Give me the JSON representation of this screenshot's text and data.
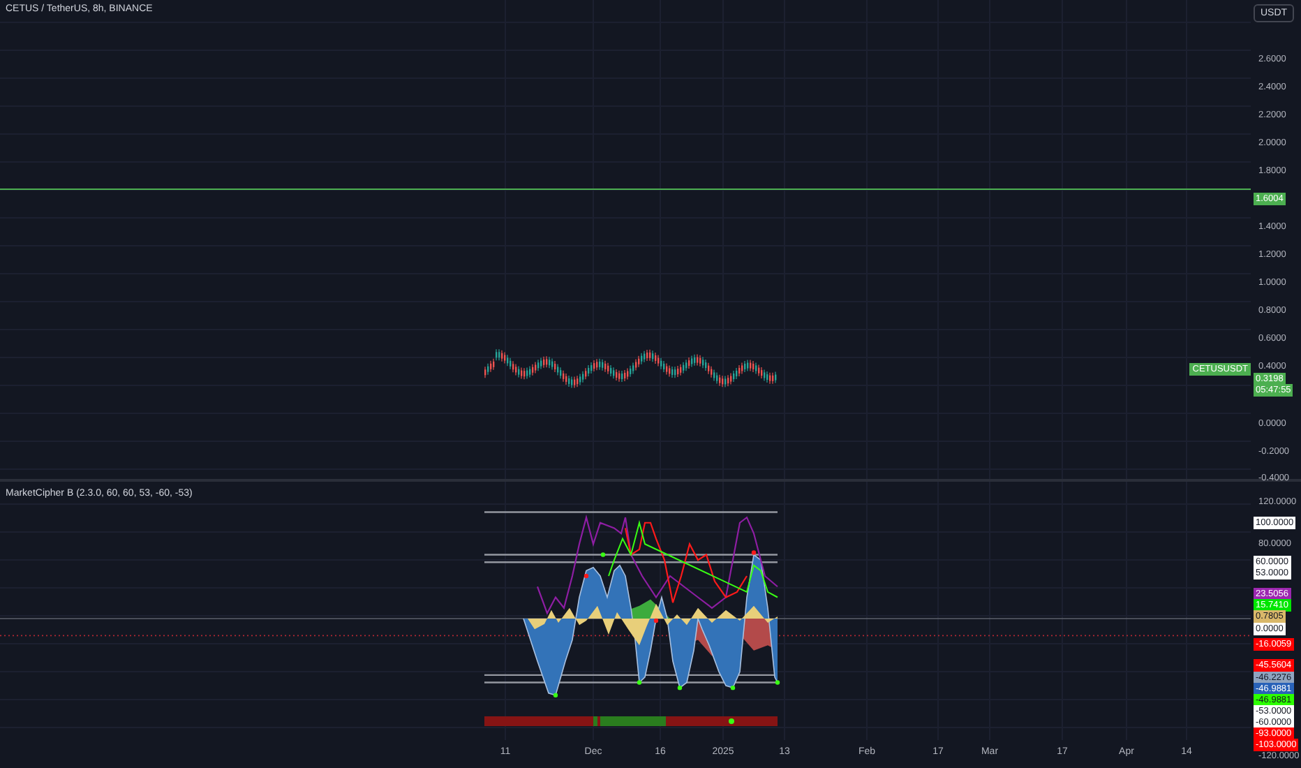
{
  "chart_title": "CETUS / TetherUS, 8h, BINANCE",
  "currency_button": "USDT",
  "price_axis": [
    {
      "kind": "tick",
      "text": "2.6000"
    },
    {
      "kind": "tick",
      "text": "2.4000"
    },
    {
      "kind": "tick",
      "text": "2.2000"
    },
    {
      "kind": "tick",
      "text": "2.0000"
    },
    {
      "kind": "tick",
      "text": "1.8000"
    },
    {
      "kind": "badge",
      "text": "1.6004",
      "color": "#4caf50"
    },
    {
      "kind": "tick",
      "text": "1.4000"
    },
    {
      "kind": "tick",
      "text": "1.2000"
    },
    {
      "kind": "tick",
      "text": "1.0000"
    },
    {
      "kind": "tick",
      "text": "0.8000"
    },
    {
      "kind": "tick",
      "text": "0.6000"
    },
    {
      "kind": "tick",
      "text": "0.4000"
    },
    {
      "kind": "badge",
      "text": "0.3198",
      "color": "#4caf50"
    },
    {
      "kind": "badge",
      "text": "05:47:55",
      "color": "#4caf50"
    },
    {
      "kind": "tick",
      "text": "0.0000"
    },
    {
      "kind": "tick",
      "text": "-0.2000"
    },
    {
      "kind": "tick",
      "text": "-0.4000"
    }
  ],
  "symbol_label": "CETUSUSDT",
  "indicator": {
    "title": "MarketCipher B (2.3.0, 60, 60, 53, -60, -53)",
    "axis": [
      {
        "kind": "tick",
        "text": "120.0000"
      },
      {
        "kind": "badge",
        "text": "100.0000",
        "color": "#ffffff"
      },
      {
        "kind": "tick",
        "text": "80.0000"
      },
      {
        "kind": "badge",
        "text": "60.0000",
        "color": "#ffffff"
      },
      {
        "kind": "badge",
        "text": "53.0000",
        "color": "#ffffff"
      },
      {
        "kind": "badge",
        "text": "23.5056",
        "color": "#9c27b0"
      },
      {
        "kind": "badge",
        "text": "15.7410",
        "color": "#00e600"
      },
      {
        "kind": "badge",
        "text": "0.7805",
        "color": "#d9b86a"
      },
      {
        "kind": "badge",
        "text": "0.0000",
        "color": "#ffffff"
      },
      {
        "kind": "badge",
        "text": "-16.0059",
        "color": "#ff0000"
      },
      {
        "kind": "badge",
        "text": "-45.5604",
        "color": "#ff0000"
      },
      {
        "kind": "badge",
        "text": "-46.2276",
        "color": "#8fa4c0"
      },
      {
        "kind": "badge",
        "text": "-46.9881",
        "color": "#2962b8"
      },
      {
        "kind": "badge",
        "text": "-46.9881",
        "color": "#2dff00"
      },
      {
        "kind": "badge",
        "text": "-53.0000",
        "color": "#ffffff"
      },
      {
        "kind": "badge",
        "text": "-60.0000",
        "color": "#ffffff"
      },
      {
        "kind": "badge",
        "text": "-93.0000",
        "color": "#ff0000"
      },
      {
        "kind": "badge",
        "text": "-103.0000",
        "color": "#ff0000"
      },
      {
        "kind": "tick",
        "text": "-120.0000"
      }
    ]
  },
  "time_axis": [
    "11",
    "Dec",
    "16",
    "2025",
    "13",
    "Feb",
    "17",
    "Mar",
    "17",
    "Apr",
    "14"
  ]
}
